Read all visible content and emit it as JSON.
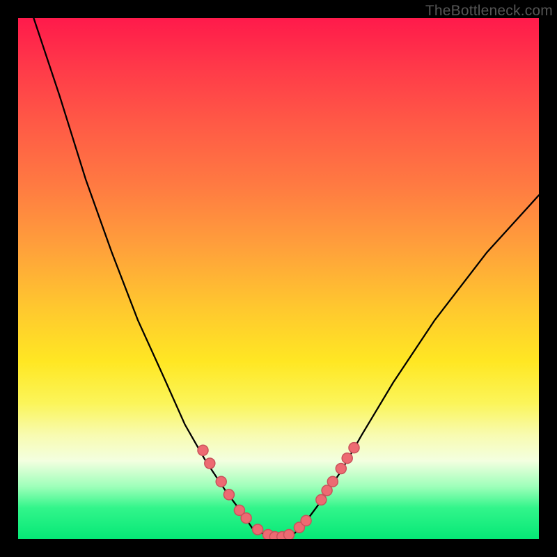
{
  "watermark": "TheBottleneck.com",
  "chart_data": {
    "type": "line",
    "title": "",
    "xlabel": "",
    "ylabel": "",
    "xlim": [
      0,
      100
    ],
    "ylim": [
      0,
      100
    ],
    "grid": false,
    "legend": false,
    "series": [
      {
        "name": "bottleneck-curve",
        "x": [
          3,
          8,
          13,
          18,
          23,
          28,
          32,
          36,
          40,
          43,
          45,
          47,
          49,
          51,
          53,
          55,
          58,
          62,
          66,
          72,
          80,
          90,
          100
        ],
        "y": [
          100,
          85,
          69,
          55,
          42,
          31,
          22,
          15,
          9,
          5,
          2,
          1,
          0,
          0,
          1,
          3,
          7,
          13,
          20,
          30,
          42,
          55,
          66
        ],
        "color": "#000000"
      }
    ],
    "markers": {
      "name": "data-points",
      "color_fill": "#ed6a72",
      "color_stroke": "#c9525b",
      "points": [
        {
          "x": 35.5,
          "y": 17.0
        },
        {
          "x": 36.8,
          "y": 14.5
        },
        {
          "x": 39.0,
          "y": 11.0
        },
        {
          "x": 40.5,
          "y": 8.5
        },
        {
          "x": 42.5,
          "y": 5.5
        },
        {
          "x": 43.8,
          "y": 4.0
        },
        {
          "x": 46.0,
          "y": 1.8
        },
        {
          "x": 48.0,
          "y": 0.8
        },
        {
          "x": 49.3,
          "y": 0.4
        },
        {
          "x": 50.7,
          "y": 0.4
        },
        {
          "x": 52.0,
          "y": 0.8
        },
        {
          "x": 54.0,
          "y": 2.2
        },
        {
          "x": 55.3,
          "y": 3.5
        },
        {
          "x": 58.2,
          "y": 7.5
        },
        {
          "x": 59.3,
          "y": 9.3
        },
        {
          "x": 60.4,
          "y": 11.0
        },
        {
          "x": 62.0,
          "y": 13.5
        },
        {
          "x": 63.2,
          "y": 15.5
        },
        {
          "x": 64.5,
          "y": 17.5
        }
      ]
    },
    "background_gradient": {
      "top": "#ff1a4b",
      "mid": "#ffe723",
      "bottom": "#05e876"
    }
  }
}
